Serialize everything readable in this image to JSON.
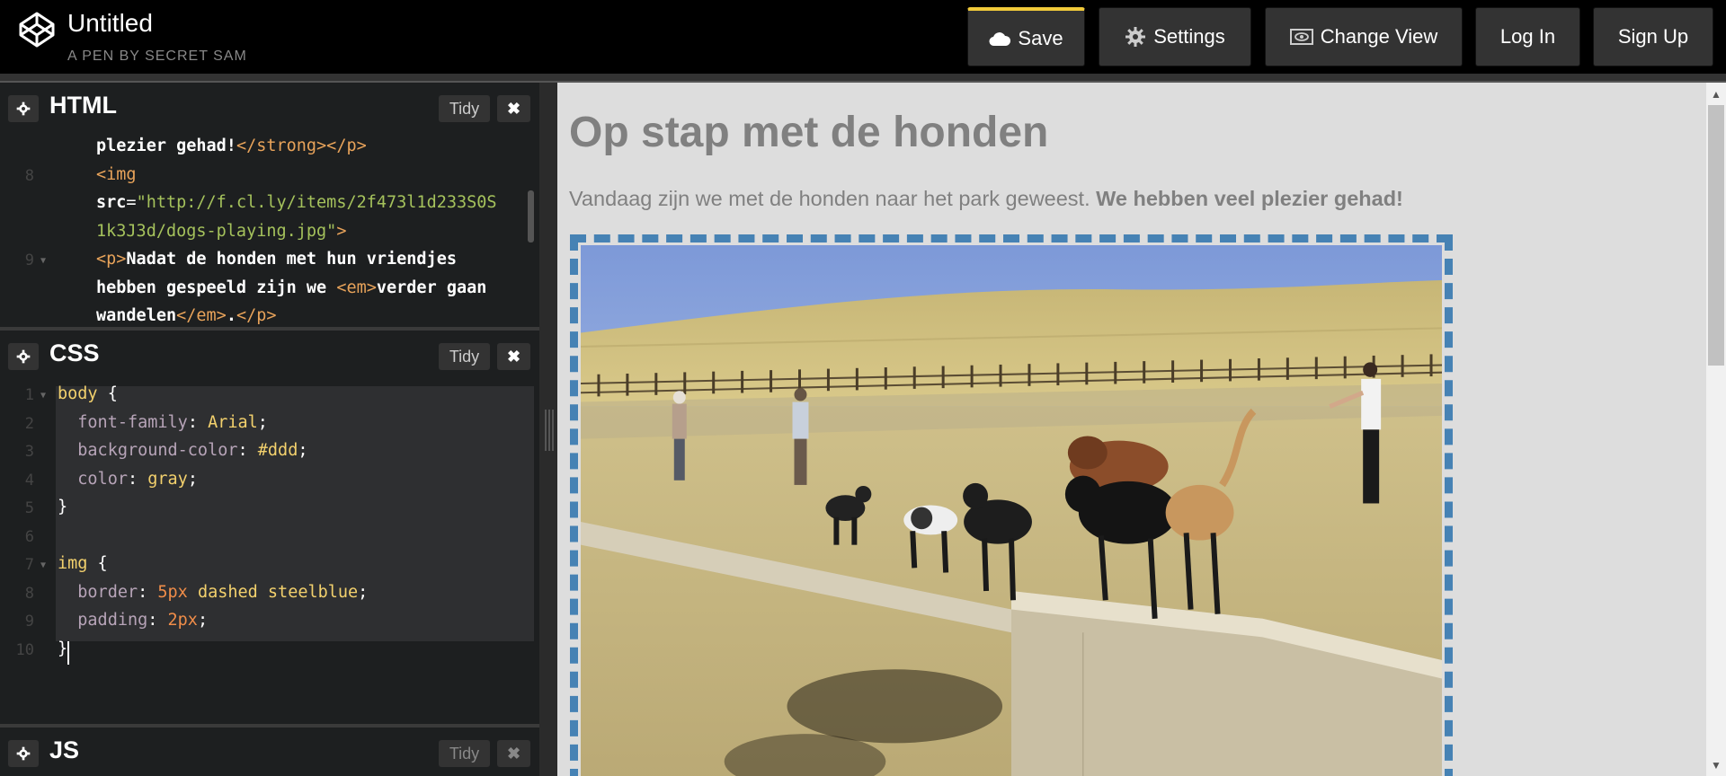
{
  "header": {
    "title": "Untitled",
    "subtitle": "A PEN BY SECRET SAM",
    "buttons": {
      "save": "Save",
      "settings": "Settings",
      "change_view": "Change View",
      "login": "Log In",
      "signup": "Sign Up"
    },
    "accent": "#f0c93a"
  },
  "editors": {
    "html": {
      "name": "HTML",
      "tidy": "Tidy",
      "lines": [
        {
          "num": "",
          "parts": [
            [
              "txt",
              "plezier gehad!"
            ],
            [
              "tag",
              "</strong></p>"
            ]
          ]
        },
        {
          "num": "8",
          "parts": [
            [
              "tag",
              "<img"
            ]
          ]
        },
        {
          "num": "",
          "parts": [
            [
              "attr",
              "src"
            ],
            [
              "punc",
              "="
            ],
            [
              "str",
              "\"http://f.cl.ly/items/2f473l1d233S0S"
            ]
          ]
        },
        {
          "num": "",
          "parts": [
            [
              "str",
              "1k3J3d/dogs-playing.jpg\""
            ],
            [
              "tag",
              ">"
            ]
          ]
        },
        {
          "num": "9",
          "fold": true,
          "parts": [
            [
              "tag",
              "<p>"
            ],
            [
              "txt",
              "Nadat de honden met hun vriendjes"
            ]
          ]
        },
        {
          "num": "",
          "parts": [
            [
              "txt",
              "hebben gespeeld zijn we "
            ],
            [
              "tag",
              "<em>"
            ],
            [
              "txt",
              "verder gaan"
            ]
          ]
        },
        {
          "num": "",
          "parts": [
            [
              "txt",
              "wandelen"
            ],
            [
              "tag",
              "</em>"
            ],
            [
              "txt",
              "."
            ],
            [
              "tag",
              "</p>"
            ]
          ]
        }
      ]
    },
    "css": {
      "name": "CSS",
      "tidy": "Tidy",
      "lines": [
        {
          "num": "1",
          "fold": true,
          "parts": [
            [
              "sel",
              "body"
            ],
            [
              "punc",
              " {"
            ]
          ]
        },
        {
          "num": "2",
          "parts": [
            [
              "punc",
              "  "
            ],
            [
              "prop",
              "font-family"
            ],
            [
              "punc",
              ": "
            ],
            [
              "val",
              "Arial"
            ],
            [
              "punc",
              ";"
            ]
          ]
        },
        {
          "num": "3",
          "parts": [
            [
              "punc",
              "  "
            ],
            [
              "prop",
              "background-color"
            ],
            [
              "punc",
              ": "
            ],
            [
              "val",
              "#ddd"
            ],
            [
              "punc",
              ";"
            ]
          ]
        },
        {
          "num": "4",
          "parts": [
            [
              "punc",
              "  "
            ],
            [
              "prop",
              "color"
            ],
            [
              "punc",
              ": "
            ],
            [
              "val",
              "gray"
            ],
            [
              "punc",
              ";"
            ]
          ]
        },
        {
          "num": "5",
          "parts": [
            [
              "punc",
              "}"
            ]
          ]
        },
        {
          "num": "6",
          "parts": []
        },
        {
          "num": "7",
          "fold": true,
          "parts": [
            [
              "sel",
              "img"
            ],
            [
              "punc",
              " {"
            ]
          ]
        },
        {
          "num": "8",
          "parts": [
            [
              "punc",
              "  "
            ],
            [
              "prop",
              "border"
            ],
            [
              "punc",
              ": "
            ],
            [
              "num",
              "5px"
            ],
            [
              "val",
              " dashed steelblue"
            ],
            [
              "punc",
              ";"
            ]
          ]
        },
        {
          "num": "9",
          "parts": [
            [
              "punc",
              "  "
            ],
            [
              "prop",
              "padding"
            ],
            [
              "punc",
              ": "
            ],
            [
              "num",
              "2px"
            ],
            [
              "punc",
              ";"
            ]
          ]
        },
        {
          "num": "10",
          "parts": [
            [
              "punc",
              "}"
            ]
          ]
        }
      ]
    },
    "js": {
      "name": "JS",
      "tidy": "Tidy"
    }
  },
  "preview": {
    "heading": "Op stap met de honden",
    "para_text": "Vandaag zijn we met de honden naar het park geweest. ",
    "para_strong": "We hebben veel plezier gehad!",
    "border_color": "#4682b4",
    "background": "#dddddd"
  }
}
